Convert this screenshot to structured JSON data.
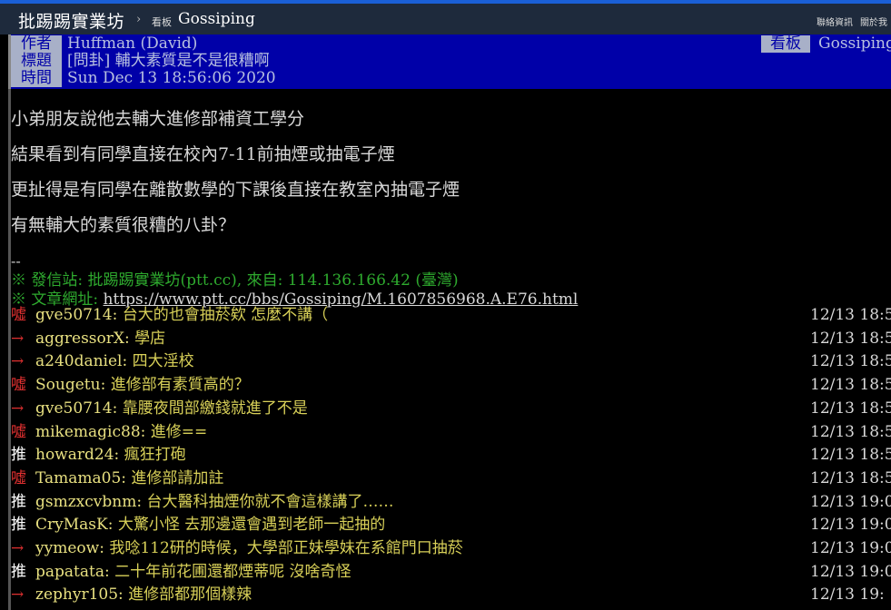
{
  "topbar": {
    "site_title": "批踢踢實業坊",
    "separator": "›",
    "board_label": "看板",
    "board_name": "Gossiping",
    "links": [
      "聯絡資訊",
      "關於我"
    ]
  },
  "header": {
    "author_label": "作者",
    "author_value": "Huffman (David)",
    "title_label": "標題",
    "title_value": "[問卦] 輔大素質是不是很糟啊",
    "time_label": "時間",
    "time_value": "Sun Dec 13 18:56:06 2020",
    "board_label": "看板",
    "board_value": "Gossiping"
  },
  "body": {
    "lines": [
      "小弟朋友說他去輔大進修部補資工學分",
      "結果看到有同學直接在校內7-11前抽煙或抽電子煙",
      "更扯得是有同學在離散數學的下課後直接在教室內抽電子煙",
      "有無輔大的素質很糟的八卦？"
    ],
    "separator": "--",
    "sig_source": "※ 發信站: 批踢踢實業坊(ptt.cc), 來自: 114.136.166.42 (臺灣)",
    "sig_url_label": "※ 文章網址: ",
    "sig_url": "https://www.ptt.cc/bbs/Gossiping/M.1607856968.A.E76.html"
  },
  "pushes": [
    {
      "tag": "噓",
      "type": "boo",
      "user": "gve50714",
      "msg": " 台大的也會抽菸欸 怎麼不講（",
      "time": "12/13 18:5"
    },
    {
      "tag": "→",
      "type": "arrow",
      "user": "aggressorX",
      "msg": " 學店",
      "time": "12/13 18:5"
    },
    {
      "tag": "→",
      "type": "arrow",
      "user": "a240daniel",
      "msg": " 四大淫校",
      "time": "12/13 18:5"
    },
    {
      "tag": "噓",
      "type": "boo",
      "user": "Sougetu",
      "msg": " 進修部有素質高的？",
      "time": "12/13 18:5"
    },
    {
      "tag": "→",
      "type": "arrow",
      "user": "gve50714",
      "msg": " 靠腰夜間部繳錢就進了不是",
      "time": "12/13 18:5"
    },
    {
      "tag": "噓",
      "type": "boo",
      "user": "mikemagic88",
      "msg": " 進修==",
      "time": "12/13 18:5"
    },
    {
      "tag": "推",
      "type": "up",
      "user": "howard24",
      "msg": " 瘋狂打砲",
      "time": "12/13 18:5"
    },
    {
      "tag": "噓",
      "type": "boo",
      "user": "Tamama05",
      "msg": " 進修部請加註",
      "time": "12/13 18:5"
    },
    {
      "tag": "推",
      "type": "up",
      "user": "gsmzxcvbnm",
      "msg": " 台大醫科抽煙你就不會這樣講了……",
      "time": "12/13 19:0"
    },
    {
      "tag": "推",
      "type": "up",
      "user": "CryMasK",
      "msg": " 大驚小怪 去那邊還會遇到老師一起抽的",
      "time": "12/13 19:0"
    },
    {
      "tag": "→",
      "type": "arrow",
      "user": "yymeow",
      "msg": " 我唸112研的時候，大學部正妹學妹在系館門口抽菸",
      "time": "12/13 19:0"
    },
    {
      "tag": "推",
      "type": "up",
      "user": "papatata",
      "msg": " 二十年前花圃還都煙蒂呢 沒啥奇怪",
      "time": "12/13 19:0"
    },
    {
      "tag": "→",
      "type": "arrow",
      "user": "zephyr105",
      "msg": " 進修部都那個樣辣",
      "time": "12/13 19:"
    }
  ]
}
